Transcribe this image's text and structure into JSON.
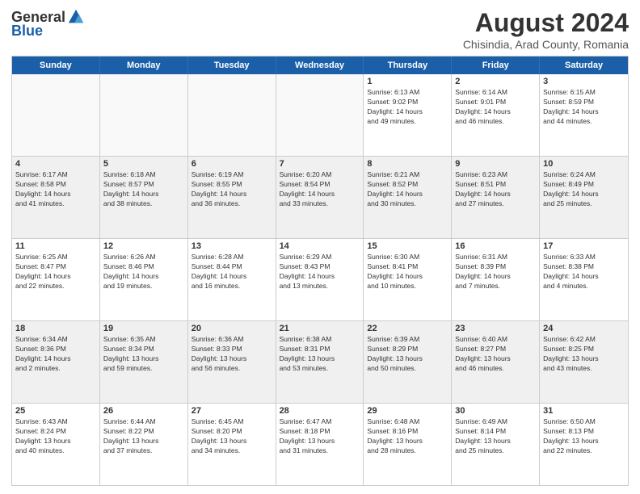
{
  "logo": {
    "general": "General",
    "blue": "Blue"
  },
  "title": "August 2024",
  "subtitle": "Chisindia, Arad County, Romania",
  "header_days": [
    "Sunday",
    "Monday",
    "Tuesday",
    "Wednesday",
    "Thursday",
    "Friday",
    "Saturday"
  ],
  "weeks": [
    [
      {
        "day": "",
        "info": "",
        "empty": true
      },
      {
        "day": "",
        "info": "",
        "empty": true
      },
      {
        "day": "",
        "info": "",
        "empty": true
      },
      {
        "day": "",
        "info": "",
        "empty": true
      },
      {
        "day": "1",
        "info": "Sunrise: 6:13 AM\nSunset: 9:02 PM\nDaylight: 14 hours\nand 49 minutes."
      },
      {
        "day": "2",
        "info": "Sunrise: 6:14 AM\nSunset: 9:01 PM\nDaylight: 14 hours\nand 46 minutes."
      },
      {
        "day": "3",
        "info": "Sunrise: 6:15 AM\nSunset: 8:59 PM\nDaylight: 14 hours\nand 44 minutes."
      }
    ],
    [
      {
        "day": "4",
        "info": "Sunrise: 6:17 AM\nSunset: 8:58 PM\nDaylight: 14 hours\nand 41 minutes."
      },
      {
        "day": "5",
        "info": "Sunrise: 6:18 AM\nSunset: 8:57 PM\nDaylight: 14 hours\nand 38 minutes."
      },
      {
        "day": "6",
        "info": "Sunrise: 6:19 AM\nSunset: 8:55 PM\nDaylight: 14 hours\nand 36 minutes."
      },
      {
        "day": "7",
        "info": "Sunrise: 6:20 AM\nSunset: 8:54 PM\nDaylight: 14 hours\nand 33 minutes."
      },
      {
        "day": "8",
        "info": "Sunrise: 6:21 AM\nSunset: 8:52 PM\nDaylight: 14 hours\nand 30 minutes."
      },
      {
        "day": "9",
        "info": "Sunrise: 6:23 AM\nSunset: 8:51 PM\nDaylight: 14 hours\nand 27 minutes."
      },
      {
        "day": "10",
        "info": "Sunrise: 6:24 AM\nSunset: 8:49 PM\nDaylight: 14 hours\nand 25 minutes."
      }
    ],
    [
      {
        "day": "11",
        "info": "Sunrise: 6:25 AM\nSunset: 8:47 PM\nDaylight: 14 hours\nand 22 minutes."
      },
      {
        "day": "12",
        "info": "Sunrise: 6:26 AM\nSunset: 8:46 PM\nDaylight: 14 hours\nand 19 minutes."
      },
      {
        "day": "13",
        "info": "Sunrise: 6:28 AM\nSunset: 8:44 PM\nDaylight: 14 hours\nand 16 minutes."
      },
      {
        "day": "14",
        "info": "Sunrise: 6:29 AM\nSunset: 8:43 PM\nDaylight: 14 hours\nand 13 minutes."
      },
      {
        "day": "15",
        "info": "Sunrise: 6:30 AM\nSunset: 8:41 PM\nDaylight: 14 hours\nand 10 minutes."
      },
      {
        "day": "16",
        "info": "Sunrise: 6:31 AM\nSunset: 8:39 PM\nDaylight: 14 hours\nand 7 minutes."
      },
      {
        "day": "17",
        "info": "Sunrise: 6:33 AM\nSunset: 8:38 PM\nDaylight: 14 hours\nand 4 minutes."
      }
    ],
    [
      {
        "day": "18",
        "info": "Sunrise: 6:34 AM\nSunset: 8:36 PM\nDaylight: 14 hours\nand 2 minutes."
      },
      {
        "day": "19",
        "info": "Sunrise: 6:35 AM\nSunset: 8:34 PM\nDaylight: 13 hours\nand 59 minutes."
      },
      {
        "day": "20",
        "info": "Sunrise: 6:36 AM\nSunset: 8:33 PM\nDaylight: 13 hours\nand 56 minutes."
      },
      {
        "day": "21",
        "info": "Sunrise: 6:38 AM\nSunset: 8:31 PM\nDaylight: 13 hours\nand 53 minutes."
      },
      {
        "day": "22",
        "info": "Sunrise: 6:39 AM\nSunset: 8:29 PM\nDaylight: 13 hours\nand 50 minutes."
      },
      {
        "day": "23",
        "info": "Sunrise: 6:40 AM\nSunset: 8:27 PM\nDaylight: 13 hours\nand 46 minutes."
      },
      {
        "day": "24",
        "info": "Sunrise: 6:42 AM\nSunset: 8:25 PM\nDaylight: 13 hours\nand 43 minutes."
      }
    ],
    [
      {
        "day": "25",
        "info": "Sunrise: 6:43 AM\nSunset: 8:24 PM\nDaylight: 13 hours\nand 40 minutes."
      },
      {
        "day": "26",
        "info": "Sunrise: 6:44 AM\nSunset: 8:22 PM\nDaylight: 13 hours\nand 37 minutes."
      },
      {
        "day": "27",
        "info": "Sunrise: 6:45 AM\nSunset: 8:20 PM\nDaylight: 13 hours\nand 34 minutes."
      },
      {
        "day": "28",
        "info": "Sunrise: 6:47 AM\nSunset: 8:18 PM\nDaylight: 13 hours\nand 31 minutes."
      },
      {
        "day": "29",
        "info": "Sunrise: 6:48 AM\nSunset: 8:16 PM\nDaylight: 13 hours\nand 28 minutes."
      },
      {
        "day": "30",
        "info": "Sunrise: 6:49 AM\nSunset: 8:14 PM\nDaylight: 13 hours\nand 25 minutes."
      },
      {
        "day": "31",
        "info": "Sunrise: 6:50 AM\nSunset: 8:13 PM\nDaylight: 13 hours\nand 22 minutes."
      }
    ]
  ]
}
